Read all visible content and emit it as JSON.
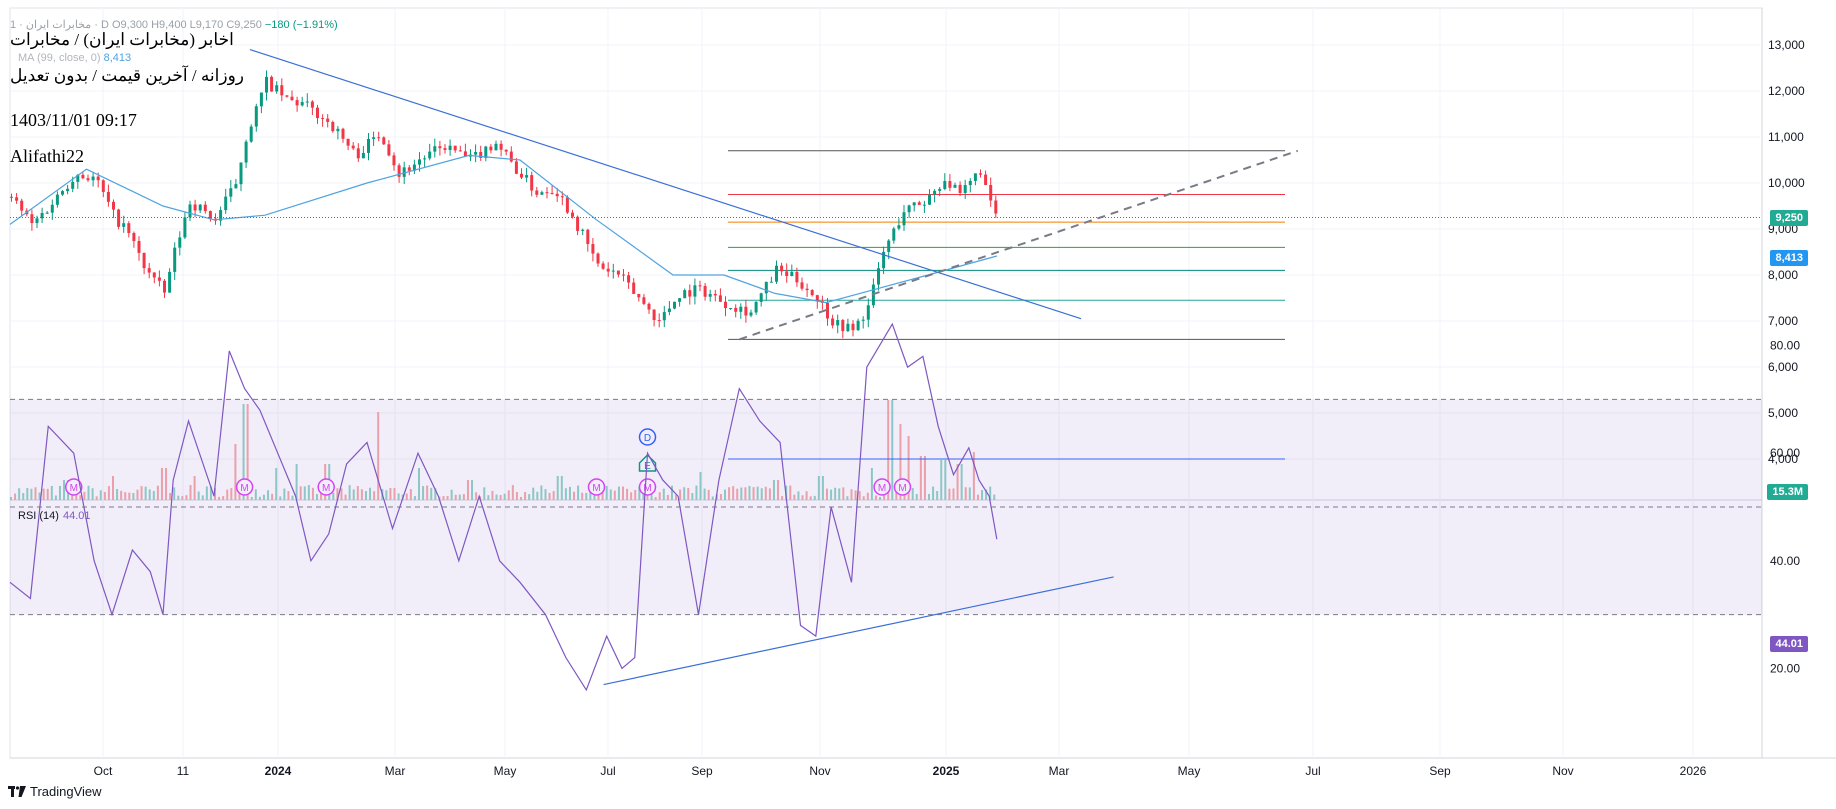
{
  "header": {
    "ohlc_prefix": "مخابرات ایران · 1 · D",
    "ohlc_values": "O9,300  H9,400  L9,170  C9,250",
    "change": "−180 (−1.91%)",
    "title": "اخابر (مخابرات ایران) / مخابرات",
    "subtitle": "روزانه / آخرین قیمت / بدون تعدیل",
    "datetime": "1403/11/01 09:17",
    "author": "Alifathi22",
    "ma_label": "MA (99, close, 0)",
    "ma_value": "8,413"
  },
  "rsi_label": {
    "name": "RSI (14)",
    "value": "44.01"
  },
  "brand": "TradingView",
  "price_tags": {
    "last": "9,250",
    "ma": "8,413",
    "volume": "15.3M",
    "rsi": "44.01"
  },
  "colors": {
    "up": "#089981",
    "down": "#f23645",
    "ma": "#4fa3e0",
    "trend": "#3b6fd8",
    "rsi": "#7e57c2",
    "last_tag": "#22ab94",
    "ma_tag": "#2196f3",
    "rsi_tag": "#7e57c2"
  },
  "chart_data": [
    {
      "type": "candlestick",
      "title": "اخابر (مخابرات ایران) / مخابرات",
      "x_ticks": [
        "Oct",
        "11",
        "2024",
        "Mar",
        "May",
        "Jul",
        "Sep",
        "Nov",
        "2025",
        "Mar",
        "May",
        "Jul",
        "Sep",
        "Nov",
        "2026"
      ],
      "y_ticks": [
        "4,000",
        "5,000",
        "6,000",
        "7,000",
        "8,000",
        "9,000",
        "10,000",
        "11,000",
        "12,000",
        "13,000"
      ],
      "ylim": [
        3700,
        13400
      ],
      "last_price": 9250,
      "ma_99_last": 8413,
      "price_path": [
        [
          0,
          9700
        ],
        [
          8,
          9100
        ],
        [
          15,
          9500
        ],
        [
          25,
          10200
        ],
        [
          33,
          10100
        ],
        [
          40,
          9300
        ],
        [
          46,
          8900
        ],
        [
          52,
          8200
        ],
        [
          60,
          7600
        ],
        [
          64,
          8500
        ],
        [
          70,
          9600
        ],
        [
          80,
          9200
        ],
        [
          88,
          10000
        ],
        [
          92,
          11000
        ],
        [
          100,
          12200
        ],
        [
          108,
          11800
        ],
        [
          115,
          11700
        ],
        [
          125,
          11300
        ],
        [
          135,
          10600
        ],
        [
          145,
          11100
        ],
        [
          152,
          10200
        ],
        [
          160,
          10500
        ],
        [
          170,
          10800
        ],
        [
          180,
          10500
        ],
        [
          190,
          10900
        ],
        [
          198,
          10300
        ],
        [
          206,
          9800
        ],
        [
          213,
          9900
        ],
        [
          220,
          9300
        ],
        [
          230,
          8200
        ],
        [
          238,
          8000
        ],
        [
          246,
          7500
        ],
        [
          254,
          7000
        ],
        [
          262,
          7600
        ],
        [
          270,
          7700
        ],
        [
          280,
          7400
        ],
        [
          290,
          7200
        ],
        [
          300,
          8100
        ],
        [
          308,
          7900
        ],
        [
          316,
          7500
        ],
        [
          322,
          7000
        ],
        [
          330,
          6800
        ],
        [
          336,
          7300
        ],
        [
          342,
          8500
        ],
        [
          350,
          9400
        ],
        [
          358,
          9600
        ],
        [
          366,
          10100
        ],
        [
          372,
          9700
        ],
        [
          380,
          10300
        ],
        [
          384,
          9500
        ],
        [
          387,
          9250
        ]
      ],
      "volume_spikes": [
        [
          22,
          5
        ],
        [
          40,
          6
        ],
        [
          60,
          8
        ],
        [
          72,
          6
        ],
        [
          88,
          14
        ],
        [
          92,
          24
        ],
        [
          104,
          8
        ],
        [
          112,
          9
        ],
        [
          124,
          9
        ],
        [
          144,
          22
        ],
        [
          160,
          8
        ],
        [
          180,
          5
        ],
        [
          215,
          6
        ],
        [
          250,
          5
        ],
        [
          270,
          7
        ],
        [
          300,
          5
        ],
        [
          318,
          6
        ],
        [
          338,
          8
        ],
        [
          345,
          25
        ],
        [
          349,
          19
        ],
        [
          352,
          16
        ],
        [
          358,
          11
        ],
        [
          366,
          10
        ],
        [
          372,
          9
        ],
        [
          378,
          12
        ]
      ],
      "event_markers": {
        "M": [
          25,
          92,
          124,
          230,
          250,
          342,
          350
        ],
        "D": [
          250
        ],
        "E": [
          250
        ]
      },
      "horizontal_levels": [
        10700,
        9750,
        9150,
        8600,
        8100,
        7450,
        6600,
        4000
      ],
      "trendline": {
        "from": [
          0,
          12400
        ],
        "to": [
          420,
          7050
        ]
      },
      "ascending_line": {
        "from": [
          286,
          6600
        ],
        "to": [
          505,
          10700
        ]
      },
      "ma_path": [
        [
          0,
          9100
        ],
        [
          30,
          10300
        ],
        [
          60,
          9500
        ],
        [
          80,
          9200
        ],
        [
          100,
          9300
        ],
        [
          140,
          10000
        ],
        [
          180,
          10600
        ],
        [
          200,
          10500
        ],
        [
          230,
          9200
        ],
        [
          260,
          8000
        ],
        [
          280,
          8000
        ],
        [
          300,
          7600
        ],
        [
          320,
          7400
        ],
        [
          340,
          7700
        ],
        [
          360,
          8000
        ],
        [
          387,
          8413
        ]
      ]
    },
    {
      "type": "line",
      "title": "RSI (14)",
      "y_ticks": [
        "20.00",
        "40.00",
        "60.00",
        "80.00"
      ],
      "ylim": [
        10,
        90
      ],
      "bands": [
        30,
        50,
        70
      ],
      "last_value": 44.01,
      "rsi_path": [
        [
          0,
          36
        ],
        [
          8,
          33
        ],
        [
          15,
          65
        ],
        [
          25,
          60
        ],
        [
          33,
          40
        ],
        [
          40,
          30
        ],
        [
          48,
          42
        ],
        [
          55,
          38
        ],
        [
          60,
          30
        ],
        [
          64,
          55
        ],
        [
          70,
          66
        ],
        [
          80,
          52
        ],
        [
          86,
          79
        ],
        [
          92,
          72
        ],
        [
          98,
          68
        ],
        [
          105,
          60
        ],
        [
          112,
          52
        ],
        [
          118,
          40
        ],
        [
          125,
          45
        ],
        [
          132,
          58
        ],
        [
          140,
          62
        ],
        [
          150,
          46
        ],
        [
          160,
          60
        ],
        [
          168,
          52
        ],
        [
          176,
          40
        ],
        [
          184,
          52
        ],
        [
          192,
          40
        ],
        [
          200,
          36
        ],
        [
          210,
          30
        ],
        [
          218,
          22
        ],
        [
          226,
          16
        ],
        [
          234,
          26
        ],
        [
          240,
          20
        ],
        [
          245,
          22
        ],
        [
          250,
          60
        ],
        [
          256,
          55
        ],
        [
          262,
          52
        ],
        [
          270,
          30
        ],
        [
          278,
          55
        ],
        [
          286,
          72
        ],
        [
          294,
          66
        ],
        [
          302,
          62
        ],
        [
          310,
          28
        ],
        [
          316,
          26
        ],
        [
          322,
          50
        ],
        [
          330,
          36
        ],
        [
          336,
          76
        ],
        [
          346,
          84
        ],
        [
          352,
          76
        ],
        [
          358,
          78
        ],
        [
          364,
          65
        ],
        [
          370,
          56
        ],
        [
          376,
          61
        ],
        [
          380,
          55
        ],
        [
          384,
          52
        ],
        [
          387,
          44.01
        ]
      ],
      "support_line": {
        "from": [
          232,
          17
        ],
        "to": [
          432,
          37
        ]
      }
    }
  ]
}
